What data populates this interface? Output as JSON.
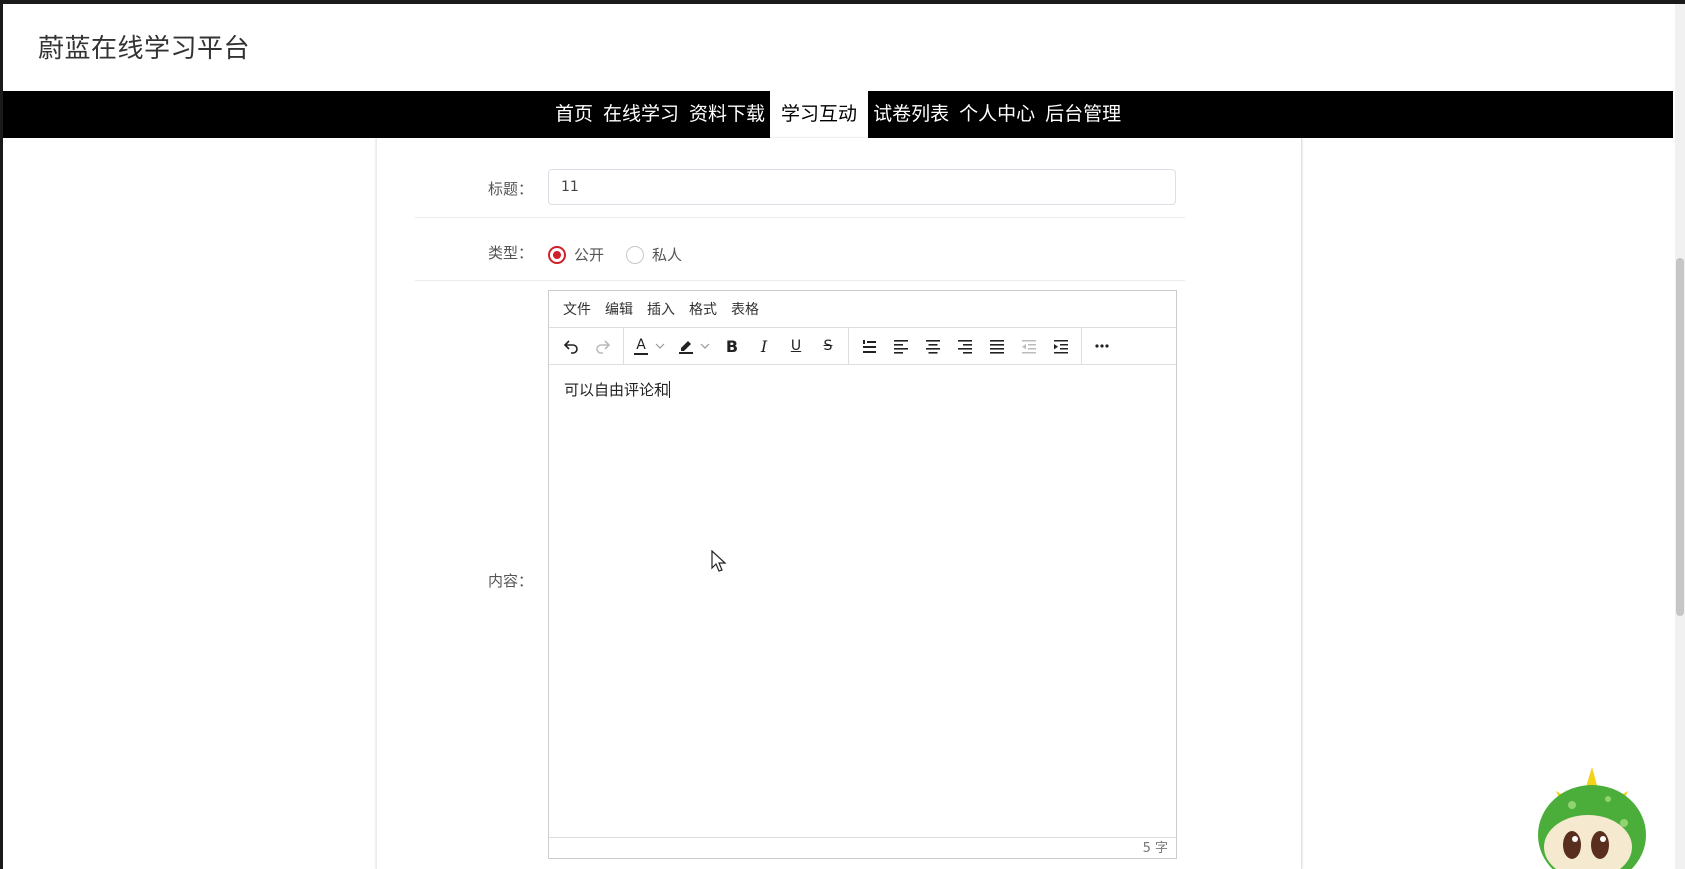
{
  "header": {
    "site_title": "蔚蓝在线学习平台"
  },
  "nav": {
    "items": [
      {
        "label": "首页",
        "active": false
      },
      {
        "label": "在线学习",
        "active": false
      },
      {
        "label": "资料下载",
        "active": false
      },
      {
        "label": "学习互动",
        "active": true
      },
      {
        "label": "试卷列表",
        "active": false
      },
      {
        "label": "个人中心",
        "active": false
      },
      {
        "label": "后台管理",
        "active": false
      }
    ]
  },
  "form": {
    "title_label": "标题：",
    "title_value": "11",
    "type_label": "类型：",
    "type_options": [
      {
        "label": "公开",
        "checked": true
      },
      {
        "label": "私人",
        "checked": false
      }
    ],
    "content_label": "内容："
  },
  "editor": {
    "menus": [
      "文件",
      "编辑",
      "插入",
      "格式",
      "表格"
    ],
    "toolbar_icons": [
      "undo-icon",
      "redo-icon",
      "text-color-icon",
      "highlight-icon",
      "bold-icon",
      "italic-icon",
      "underline-icon",
      "strikethrough-icon",
      "numbered-list-icon",
      "align-left-icon",
      "align-center-icon",
      "align-right-icon",
      "align-justify-icon",
      "outdent-icon",
      "indent-icon",
      "more-icon"
    ],
    "toolbar_text": {
      "text_color": "A",
      "bold": "B",
      "italic": "I",
      "underline": "U",
      "strike": "S"
    },
    "content": "可以自由评论和",
    "word_count": "5 字"
  },
  "colors": {
    "accent": "#d0212a",
    "navbar_bg": "#000000"
  }
}
